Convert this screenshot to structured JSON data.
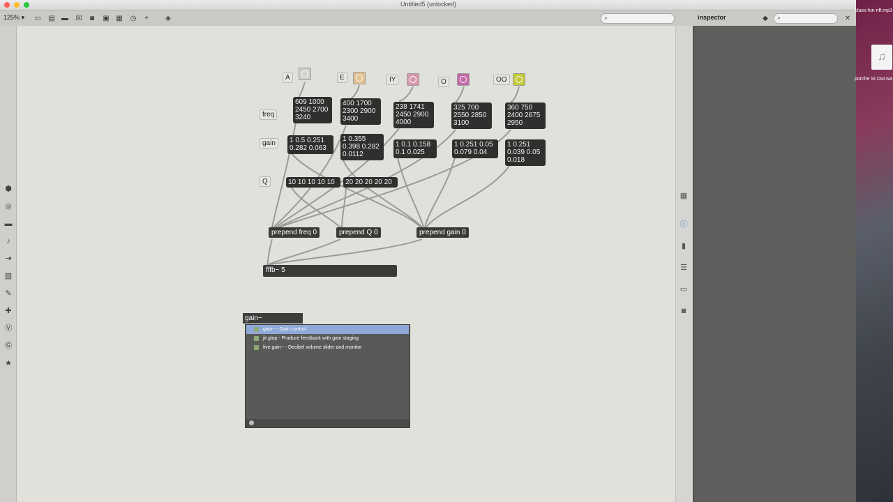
{
  "window": {
    "title": "Untitled5 (unlocked)"
  },
  "toolbar": {
    "zoom": "125% ▾",
    "inspector_label": "inspector"
  },
  "desktop": {
    "file1": "blues fun riff.mp3",
    "file2": "porche St Out.wa"
  },
  "patch": {
    "vowels": [
      {
        "label": "A",
        "button_color": "#9ad7c0"
      },
      {
        "label": "E",
        "button_color": "#e8b870"
      },
      {
        "label": "IY",
        "button_color": "#d98aa0"
      },
      {
        "label": "O",
        "button_color": "#c36aa8"
      },
      {
        "label": "OO",
        "button_color": "#c4c93a"
      }
    ],
    "labels": {
      "freq": "freq",
      "gain": "gain",
      "q": "Q"
    },
    "freq_lists": [
      "609 1000\n2450 2700\n3240",
      "400 1700\n2300 2900\n3400",
      "238 1741\n2450 2900\n4000",
      "325 700\n2550 2850\n3100",
      "360 750\n2400 2675\n2950"
    ],
    "gain_lists": [
      "1 0.5 0.251\n0.282 0.063",
      "1 0.355\n0.398 0.282\n0.0112",
      "1 0.1 0.158\n0.1 0.025",
      "1 0.251 0.05\n0.079 0.04",
      "1 0.251\n0.039 0.05\n0.018"
    ],
    "q_lists": [
      "10 10 10 10 10",
      "20 20 20 20 20"
    ],
    "prepend": [
      "prepend freq 0",
      "prepend Q 0",
      "prepend gain 0"
    ],
    "fffb": "fffb~ 5"
  },
  "autocomplete": {
    "input_text": "gain~",
    "items": [
      "gain~ - Gain control",
      "jit.glop - Produce feedback with gain staging",
      "live.gain~ - Decibel volume slider and monitor"
    ],
    "highlight_color": "#8fa8d8"
  }
}
